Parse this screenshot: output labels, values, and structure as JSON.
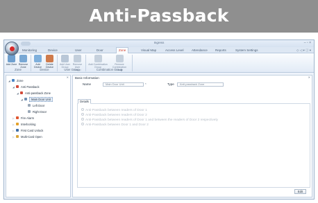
{
  "banner": {
    "title": "Anti-Passback"
  },
  "app": {
    "title": "Ingress",
    "window_controls": "– ▫ ×",
    "help_controls": "◇ ◁ ▾ ⓘ ▾"
  },
  "menu": {
    "items": [
      {
        "label": "Monitoring",
        "active": false
      },
      {
        "label": "Device",
        "active": false
      },
      {
        "label": "User",
        "active": false
      },
      {
        "label": "Door",
        "active": false
      },
      {
        "label": "Zone",
        "active": true
      },
      {
        "label": "Visual Map",
        "active": false
      },
      {
        "label": "Access Level",
        "active": false
      },
      {
        "label": "Attendance",
        "active": false
      },
      {
        "label": "Reports",
        "active": false
      },
      {
        "label": "System Settings",
        "active": false
      }
    ]
  },
  "ribbon": {
    "buttons": [
      {
        "label": "Add Zone",
        "icon": "add-zone-icon",
        "enabled": true,
        "color": "#6fa0cf"
      },
      {
        "label": "Remove Zone",
        "icon": "remove-zone-icon",
        "enabled": true,
        "color": "#79a8d4"
      },
      {
        "label": "Add Device",
        "icon": "add-device-icon",
        "enabled": true,
        "color": "#7fb0dc"
      },
      {
        "label": "Delete Device",
        "icon": "delete-device-icon",
        "enabled": true,
        "color": "#cf7b4c"
      },
      {
        "label": "Add User Group",
        "icon": "add-user-group-icon",
        "enabled": false,
        "color": "#b9c7d7"
      },
      {
        "label": "Remove User Group",
        "icon": "remove-user-group-icon",
        "enabled": false,
        "color": "#c3cfdc"
      },
      {
        "label": "Add Combination Group",
        "icon": "add-combination-group-icon",
        "enabled": false,
        "color": "#c6d1dd"
      },
      {
        "label": "Remove Combination Group",
        "icon": "remove-combination-group-icon",
        "enabled": false,
        "color": "#c6d1dd"
      }
    ],
    "groups": [
      "Zone",
      "Device",
      "User Group",
      "Combination Group"
    ]
  },
  "tree": {
    "items": [
      {
        "label": "Zone",
        "twisty": "◢",
        "icon": "zone-icon",
        "color": "#4a86c5"
      },
      {
        "label": "Anti Passback",
        "twisty": "◢",
        "icon": "anti-passback-icon",
        "color": "#d24a3a"
      },
      {
        "label": "Anti-passback Zone",
        "twisty": "◢",
        "icon": "anti-passback-zone-icon",
        "color": "#d24a3a"
      },
      {
        "label": "Main Door Unit",
        "twisty": "◢",
        "icon": "door-unit-icon",
        "color": "#6f8fb3"
      },
      {
        "label": "Left Door",
        "twisty": "",
        "icon": "door-icon",
        "color": "#9aa8b8"
      },
      {
        "label": "Right Door",
        "twisty": "",
        "icon": "door-icon",
        "color": "#9aa8b8"
      },
      {
        "label": "Fire Alarm",
        "twisty": "▷",
        "icon": "fire-alarm-icon",
        "color": "#e0562f"
      },
      {
        "label": "Interlocking",
        "twisty": "▷",
        "icon": "interlocking-icon",
        "color": "#e3a22c"
      },
      {
        "label": "First Card Unlock",
        "twisty": "▷",
        "icon": "first-card-unlock-icon",
        "color": "#3f6fa8"
      },
      {
        "label": "Multi-Card Open",
        "twisty": "▷",
        "icon": "multi-card-open-icon",
        "color": "#d9a53a"
      }
    ]
  },
  "form": {
    "section_title": "Basic Information",
    "name_label": "Name",
    "name_value": "Main Door Unit",
    "required_mark": "*",
    "type_label": "Type",
    "type_value": "Anti-passback Zone",
    "tab_label": "Details",
    "options": [
      "Anti-Passback between readers of Door 1",
      "Anti-Passback between readers of Door 2",
      "Anti-Passback between readers of Door 1 and between the readers of Door 2 respectively",
      "Anti-Passback between Door 1 and Door 2"
    ],
    "edit_label": "Edit"
  },
  "colors": {
    "banner": "#8f8f8f",
    "active_menu": "#d23a26",
    "frame": "#9fb4cc"
  }
}
